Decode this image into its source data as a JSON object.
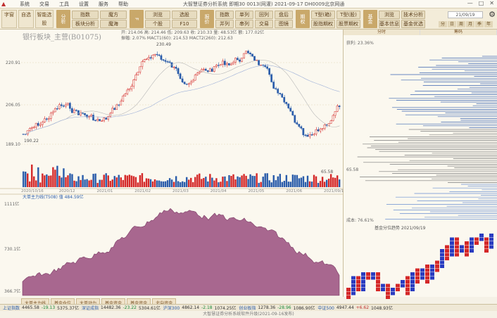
{
  "menu": {
    "items": [
      "系统",
      "交易",
      "工具",
      "设置",
      "服务",
      "帮助"
    ],
    "title": "大智慧证券分析系统  即期30 0013(网灌)  2021-09-17 DH0009北京网通"
  },
  "toolbar": {
    "left_tabs": [
      "字窗",
      "自选",
      "智能选股"
    ],
    "groups": [
      {
        "tab": "分析",
        "buttons": [
          "指数",
          "魔方",
          "板块分析",
          "魔海"
        ]
      },
      {
        "tab": "F",
        "buttons": [
          "浏览",
          "选股",
          "个股",
          "F10"
        ]
      },
      {
        "tab": "报价",
        "buttons": [
          "指数",
          "单列",
          "回列",
          "盘后",
          "并列",
          "串列",
          "交易",
          "图镜"
        ]
      },
      {
        "tab": "期权",
        "buttons": [
          "T型(箱)",
          "T型(股)",
          "股指期权",
          "股票期权"
        ]
      },
      {
        "tab": "基金",
        "buttons": [
          "浏览",
          "技术分析",
          "基本信息",
          "基金优选"
        ]
      }
    ],
    "date": "21/09/19",
    "periods": [
      "分",
      "日",
      "周",
      "月",
      "季",
      "年"
    ]
  },
  "main": {
    "title": "银行板块_主营(B01075)",
    "stats_line1": "开: 214.06 高: 214.46 低: 209.63 收: 210.33 量: 48.53亿 额: 177.02亿",
    "stats_line2": "振幅: 2.07% MACT1(60): 214.53 MACT2(260): 212.63",
    "high_label": "230.49",
    "low_label": "190.22",
    "price_ticks": [
      "220.91",
      "206.05",
      "189.10"
    ],
    "vol_label": "成交量",
    "vol_value": "65.58",
    "x_ticks": [
      "2020/10/16",
      "2020/12",
      "2021/01",
      "2021/02",
      "2021/03",
      "2021/04",
      "2021/05",
      "2021/06",
      "2021/09/19"
    ],
    "sub_title": "大单主力线(T508) 值 484.59亿",
    "sub_ticks": [
      "1111亿",
      "730.1亿",
      "366.7亿"
    ]
  },
  "right": {
    "tabs": [
      "分时",
      "筹码"
    ],
    "profit_label": "获利: 23.36%",
    "avg_label": "65.58",
    "cost_label": "成本: 76.61%",
    "fund_title": "基金分位趋势 2021/09/19"
  },
  "bottom_tabs": [
    "大单主力线",
    "基金仓位",
    "大单动力",
    "基金资金",
    "基金资金",
    "北向资金"
  ],
  "status": [
    {
      "name": "上证指数",
      "value": "4465.58",
      "change": "-19.13",
      "extra": "5375.37亿",
      "dir": "neg"
    },
    {
      "name": "深证成指",
      "value": "14482.36",
      "change": "-23.22",
      "extra": "5304.61亿",
      "dir": "neg"
    },
    {
      "name": "沪深300",
      "value": "4862.14",
      "change": "-2.18",
      "extra": "1074.25亿",
      "dir": "neg"
    },
    {
      "name": "创业板指",
      "value": "1278.36",
      "change": "-28.96",
      "extra": "1086.90亿",
      "dir": "neg"
    },
    {
      "name": "中证500",
      "value": "4947.44",
      "change": "+6.62",
      "extra": "1048.93亿",
      "dir": "pos"
    }
  ],
  "footer": "大智慧证券分析系统软件升级(2021-09-16发布)",
  "colors": {
    "up": "#d42828",
    "down": "#2a5caa",
    "vol_up": "#d42828",
    "vol_down": "#2a5caa",
    "area": "#a8678f",
    "grid": "#e0d8c0"
  }
}
